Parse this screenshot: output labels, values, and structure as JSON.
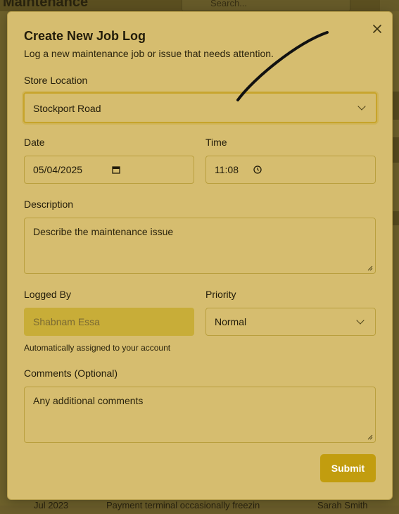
{
  "background": {
    "page_title": "Maintenance",
    "search_placeholder": "Search...",
    "row": {
      "date": "Jul 2023",
      "description": "Payment terminal occasionally freezin",
      "person": "Sarah Smith"
    }
  },
  "modal": {
    "title": "Create New Job Log",
    "subtitle": "Log a new maintenance job or issue that needs attention.",
    "close_icon": "close-icon",
    "store_location": {
      "label": "Store Location",
      "value": "Stockport Road"
    },
    "date": {
      "label": "Date",
      "value": "05/04/2025"
    },
    "time": {
      "label": "Time",
      "value": "11:08"
    },
    "description": {
      "label": "Description",
      "placeholder": "Describe the maintenance issue"
    },
    "logged_by": {
      "label": "Logged By",
      "value": "Shabnam Essa",
      "help": "Automatically assigned to your account"
    },
    "priority": {
      "label": "Priority",
      "value": "Normal"
    },
    "comments": {
      "label": "Comments (Optional)",
      "placeholder": "Any additional comments"
    },
    "submit_label": "Submit"
  },
  "colors": {
    "modal_bg": "#d6bd6f",
    "accent": "#c29d0f",
    "field_border": "#b99f3e"
  }
}
